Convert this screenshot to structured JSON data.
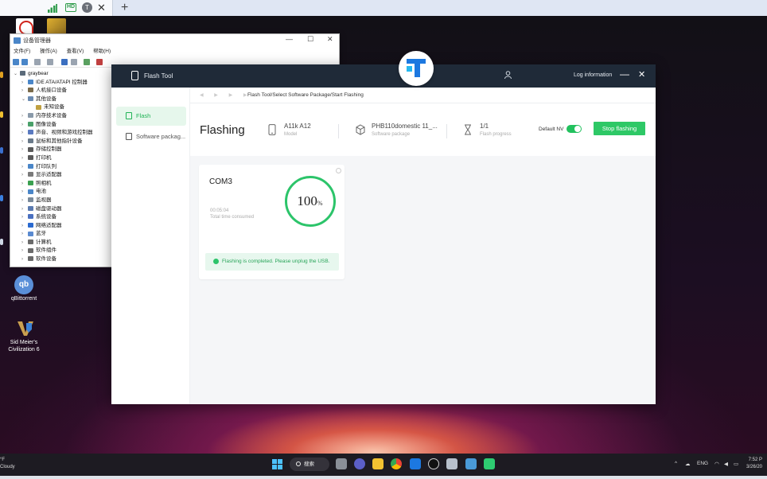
{
  "colors": {
    "accent_green": "#2ec866",
    "titlebar_dark": "#1f2a38",
    "active_nav_bg": "#e6f7ec",
    "done_bg": "#e7f7ee"
  },
  "desktop": {
    "icons": [
      {
        "name": "qbittorrent",
        "icon": "qb",
        "label": "qBittorrent"
      },
      {
        "name": "civ6",
        "icon": "civ-icon",
        "label_line1": "Sid Meier's",
        "label_line2": "Civilization 6"
      }
    ]
  },
  "device_manager": {
    "title": "设备管理器",
    "menu": [
      "文件(F)",
      "操作(A)",
      "查看(V)",
      "帮助(H)"
    ],
    "tree": [
      {
        "label": "graybear",
        "level": 0,
        "expanded": true
      },
      {
        "label": "IDE ATA/ATAPI 控制器",
        "level": 1
      },
      {
        "label": "人机接口设备",
        "level": 1
      },
      {
        "label": "其他设备",
        "level": 1,
        "expanded": true
      },
      {
        "label": "未知设备",
        "level": 2
      },
      {
        "label": "内存技术设备",
        "level": 1
      },
      {
        "label": "图像设备",
        "level": 1
      },
      {
        "label": "声音、视频和游戏控制器",
        "level": 1
      },
      {
        "label": "鼠标和其他指针设备",
        "level": 1
      },
      {
        "label": "存储控制器",
        "level": 1
      },
      {
        "label": "打印机",
        "level": 1
      },
      {
        "label": "打印队列",
        "level": 1
      },
      {
        "label": "显示适配器",
        "level": 1
      },
      {
        "label": "照相机",
        "level": 1
      },
      {
        "label": "电池",
        "level": 1
      },
      {
        "label": "监视器",
        "level": 1
      },
      {
        "label": "磁盘驱动器",
        "level": 1
      },
      {
        "label": "系统设备",
        "level": 1
      },
      {
        "label": "网络适配器",
        "level": 1
      },
      {
        "label": "蓝牙",
        "level": 1
      },
      {
        "label": "计算机",
        "level": 1
      },
      {
        "label": "软件组件",
        "level": 1
      },
      {
        "label": "软件设备",
        "level": 1
      }
    ]
  },
  "flash_tool": {
    "app_name": "Flash Tool",
    "log_info": "Log information",
    "nav": [
      {
        "label": "Flash",
        "icon": "flash-icon",
        "active": true
      },
      {
        "label": "Software packag...",
        "icon": "package-icon",
        "active": false
      }
    ],
    "breadcrumb": "Flash Tool/Select Software Package/Start Flashing",
    "heading": "Flashing",
    "stats": [
      {
        "value": "A11k A12",
        "label": "Model",
        "icon": "phone-icon"
      },
      {
        "value": "PHB110domestic 11_...",
        "label": "Software package",
        "icon": "box-icon"
      },
      {
        "value": "1/1",
        "label": "Flash progress",
        "icon": "hourglass-icon"
      }
    ],
    "default_nv_label": "Default NV",
    "default_nv_on": true,
    "stop_button": "Stop flashing",
    "card": {
      "port": "COM3",
      "time": "00:05:04",
      "time_label": "Total time consumed",
      "progress_text": "100",
      "progress_unit": "%",
      "progress_percent": 100,
      "done_message": "Flashing is completed. Please unplug the USB."
    }
  },
  "taskbar": {
    "weather_line1": "°F",
    "weather_line2": "Cloudy",
    "search": "搜索",
    "lang": "ENG",
    "time": "7:52 P",
    "date": "3/26/20"
  }
}
